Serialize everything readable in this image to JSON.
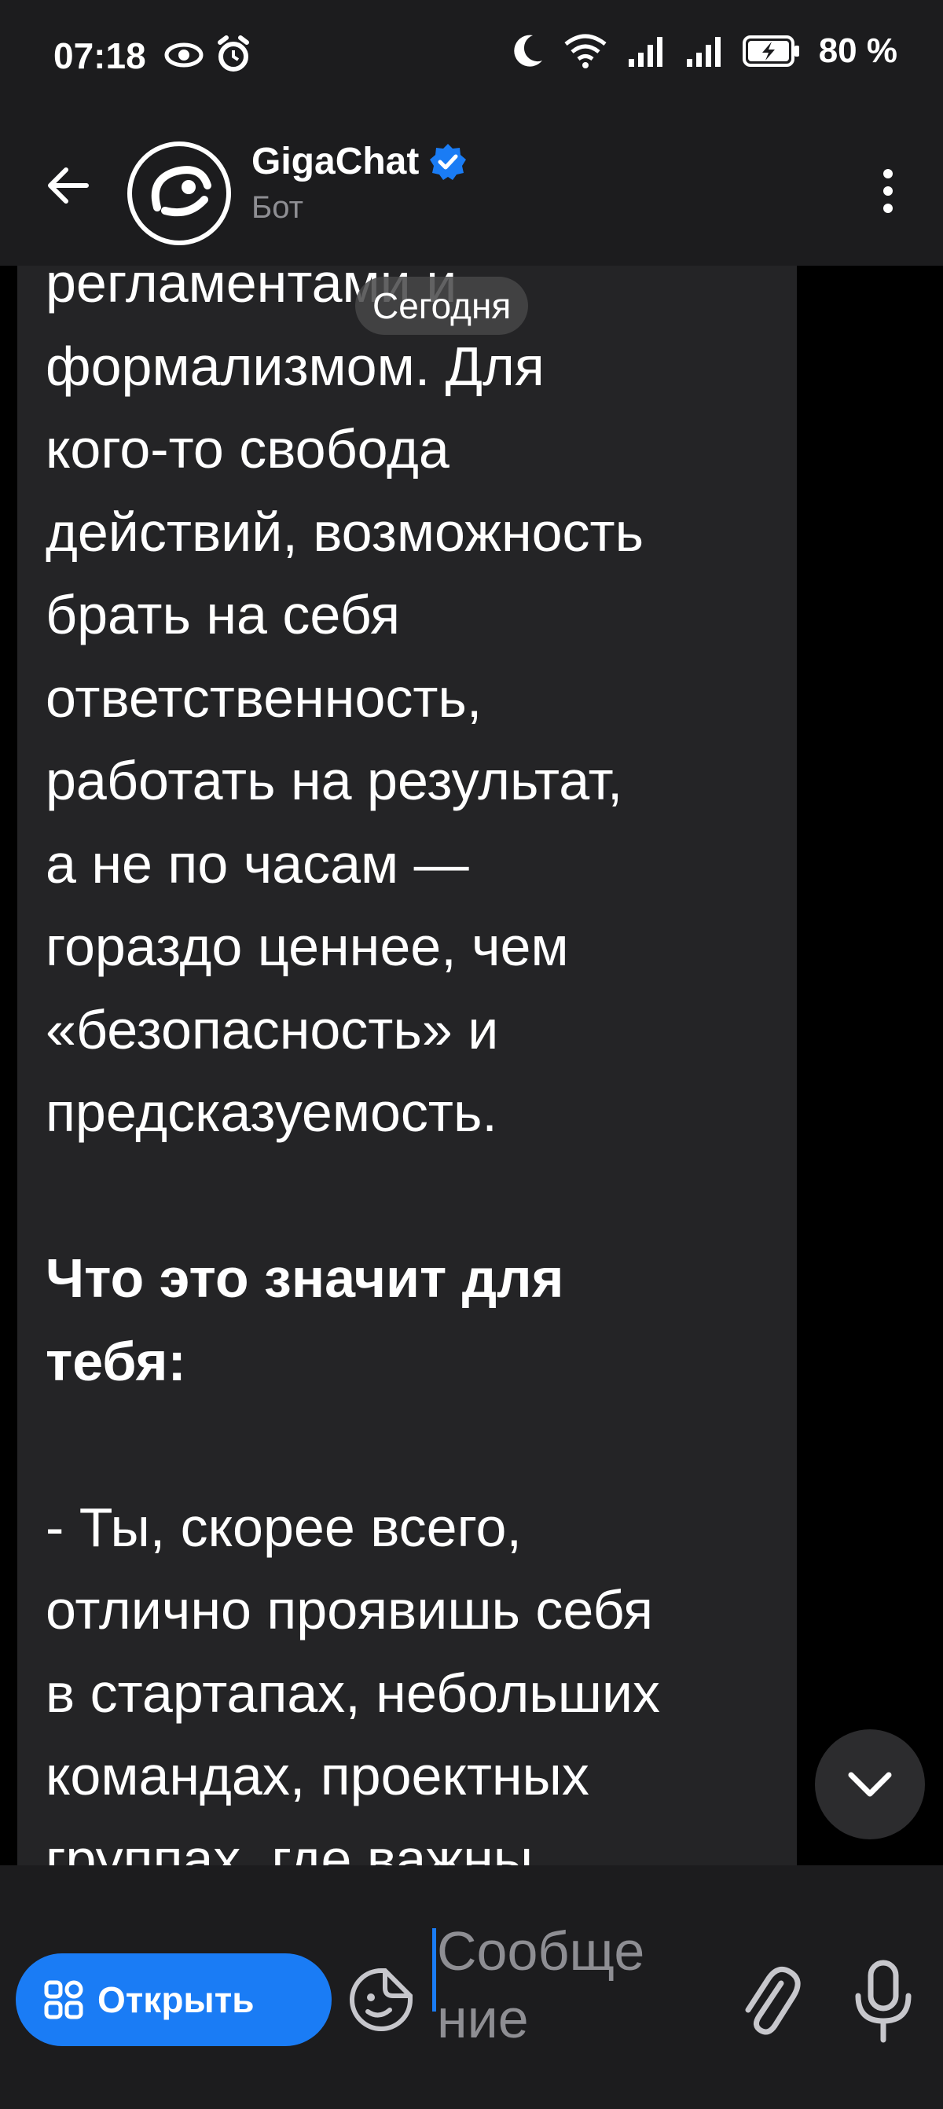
{
  "status_bar": {
    "time": "07:18",
    "battery_text": "80 %"
  },
  "header": {
    "title": "GigaChat",
    "subtitle": "Бот"
  },
  "chat": {
    "date_chip": "Сегодня",
    "message_part1": "регламентами и\nформализмом. Для\nкого-то свобода\nдействий, возможность\nбрать на себя\nответственность,\nработать на результат,\nа не по часам —\nгораздо ценнее, чем\n«безопасность» и\nпредсказуемость.\n\n",
    "message_heading": "Что это значит для\nтебя:",
    "message_part2": "\n\n- Ты, скорее всего,\nотлично проявишь себя\nв стартапах, небольших\nкомандах, проектных\nгруппах, где важны\nинициатива, гибкость и\nготовность «закрывать"
  },
  "input_bar": {
    "open_button_label": "Открыть",
    "placeholder": "Сообще\nние"
  },
  "colors": {
    "accent": "#1a7cf5",
    "bubble": "#242426",
    "bar": "#1c1c1e"
  }
}
